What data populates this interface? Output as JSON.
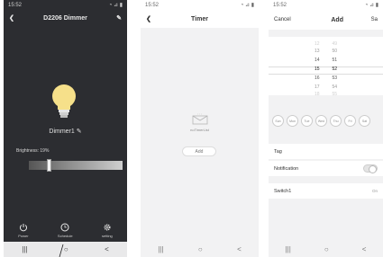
{
  "phone1": {
    "status_time": "15:52",
    "status_icons": "◔ ⊿ ▮",
    "title": "D2206 Dimmer",
    "device_name": "Dimmer1",
    "brightness_label": "Brightness: 19%",
    "brightness_level": 0.19,
    "bottom": {
      "power": "Power",
      "schedule": "Schedule",
      "setting": "setting"
    },
    "nav": {
      "recents": "|||",
      "home": "○",
      "back": "<"
    }
  },
  "phone2": {
    "status_time": "15:52",
    "status_icons": "◔ ⊿ ▮",
    "title": "Timer",
    "empty_text": "noTimerList",
    "add_label": "Add",
    "nav": {
      "recents": "|||",
      "home": "○",
      "back": "<"
    }
  },
  "phone3": {
    "status_time": "15:52",
    "status_icons": "◔ ⊿ ▮",
    "cancel": "Cancel",
    "title": "Add",
    "save": "Sa",
    "hours": [
      "12",
      "13",
      "14",
      "15",
      "16",
      "17",
      "18"
    ],
    "minutes": [
      "49",
      "50",
      "51",
      "52",
      "53",
      "54",
      "55"
    ],
    "days": [
      "Sun",
      "Mon",
      "Tue",
      "Wed",
      "Thu",
      "Fri",
      "Sat"
    ],
    "tag_label": "Tag",
    "notification_label": "Notification",
    "switch_label": "Switch1",
    "switch_value": "On",
    "nav": {
      "recents": "|||",
      "home": "○",
      "back": "<"
    }
  }
}
